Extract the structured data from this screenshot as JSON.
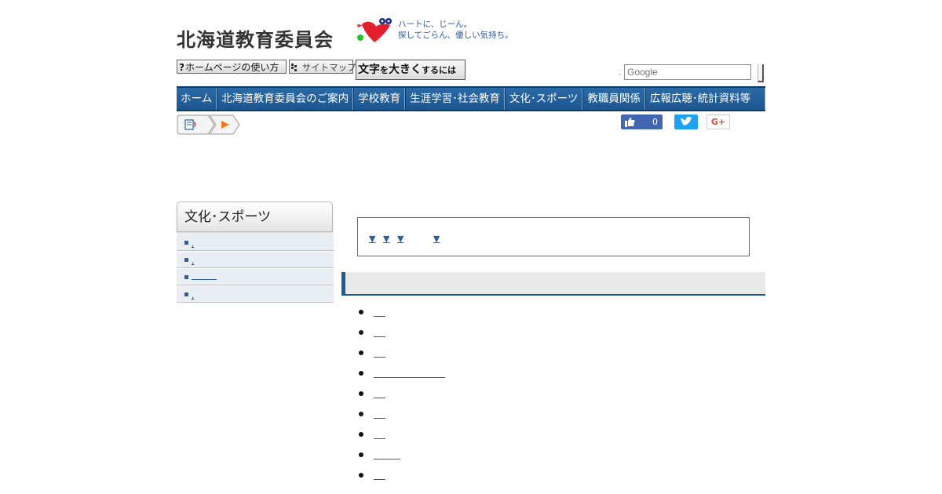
{
  "header": {
    "site_title": "北海道教育委員会",
    "tagline_line1": "ハートに、じーん。",
    "tagline_line2": "探してごらん、優しい気持ち。"
  },
  "utility": {
    "help_icon": "?",
    "help_label": "ホームページの使い方",
    "sitemap_label": "サイトマップ",
    "bigtext_main": "文字",
    "bigtext_small1": "を",
    "bigtext_main2": "大きく",
    "bigtext_small2": "するには",
    "search_placeholder": "Google",
    "search_prefix": "."
  },
  "nav": {
    "items": [
      {
        "label": "ホーム"
      },
      {
        "label": "北海道教育委員会のご案内"
      },
      {
        "label": "学校教育"
      },
      {
        "label": "生涯学習･社会教育"
      },
      {
        "label": "文化･スポーツ"
      },
      {
        "label": "教職員関係"
      },
      {
        "label": "広報広聴･統計資料等"
      }
    ]
  },
  "social": {
    "like_count": "0",
    "like_icon": "thumbs-up-icon",
    "twitter_icon": "twitter-bird-icon",
    "gplus_label": "G+"
  },
  "sidebar": {
    "title": "文化･スポーツ",
    "items": [
      {
        "label": ","
      },
      {
        "label": ","
      },
      {
        "label": ""
      },
      {
        "label": ","
      }
    ]
  },
  "anchors": {
    "glyph": "▼"
  },
  "colors": {
    "nav_bg": "#1d5a92",
    "link": "#2a5fa0",
    "tagline": "#2a5a9a"
  }
}
